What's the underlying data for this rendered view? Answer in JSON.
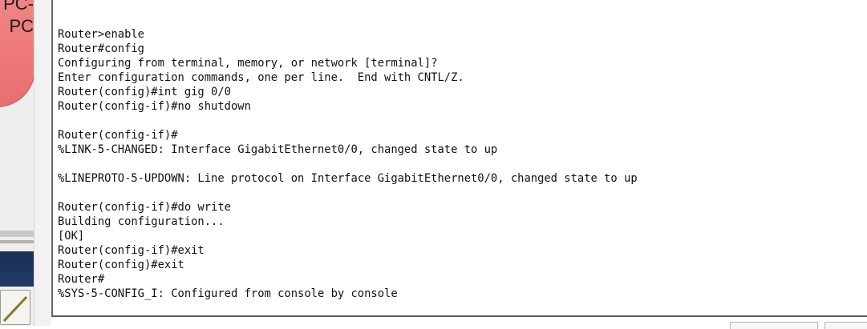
{
  "workspace": {
    "device_label_line1": "PC-",
    "device_label_line2": "PC",
    "icon": "cable-icon"
  },
  "terminal": {
    "lines": [
      "Router>enable",
      "Router#config",
      "Configuring from terminal, memory, or network [terminal]?",
      "Enter configuration commands, one per line.  End with CNTL/Z.",
      "Router(config)#int gig 0/0",
      "Router(config-if)#no shutdown",
      "",
      "Router(config-if)#",
      "%LINK-5-CHANGED: Interface GigabitEthernet0/0, changed state to up",
      "",
      "%LINEPROTO-5-UPDOWN: Line protocol on Interface GigabitEthernet0/0, changed state to up",
      "",
      "Router(config-if)#do write",
      "Building configuration...",
      "[OK]",
      "Router(config-if)#exit",
      "Router(config)#exit",
      "Router#",
      "%SYS-5-CONFIG_I: Configured from console by console"
    ]
  },
  "colors": {
    "pc_bubble": "#f07b7b",
    "navy_panel": "#1b2f55",
    "terminal_text": "#111111"
  }
}
